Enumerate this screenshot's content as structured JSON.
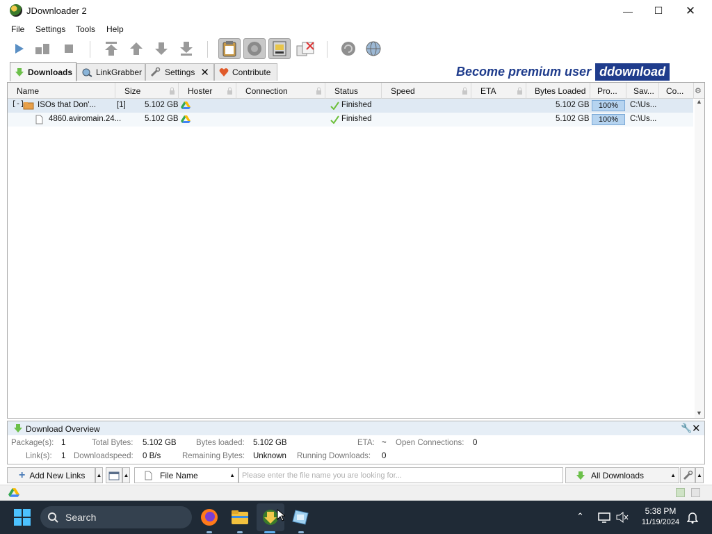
{
  "window": {
    "title": "JDownloader 2"
  },
  "menu": [
    "File",
    "Settings",
    "Tools",
    "Help"
  ],
  "tabs": [
    {
      "label": "Downloads"
    },
    {
      "label": "LinkGrabber"
    },
    {
      "label": "Settings"
    },
    {
      "label": "Contribute"
    }
  ],
  "premium": {
    "text": "Become premium user",
    "brand": "ddownload"
  },
  "columns": [
    "Name",
    "Size",
    "Hoster",
    "Connection",
    "Status",
    "Speed",
    "ETA",
    "Bytes Loaded",
    "Pro...",
    "Sav...",
    "Co..."
  ],
  "rows": [
    {
      "expander": "[-]",
      "name": "ISOs that Don'...",
      "count": "[1]",
      "size": "5.102 GB",
      "status": "Finished",
      "bytes": "5.102 GB",
      "progress": "100%",
      "progress_value": 100,
      "save": "C:\\Us..."
    },
    {
      "name": "4860.aviromain.24...",
      "size": "5.102 GB",
      "status": "Finished",
      "bytes": "5.102 GB",
      "progress": "100%",
      "progress_value": 100,
      "save": "C:\\Us..."
    }
  ],
  "overview": {
    "title": "Download Overview",
    "packages_label": "Package(s):",
    "packages": "1",
    "total_bytes_label": "Total Bytes:",
    "total_bytes": "5.102 GB",
    "bytes_loaded_label": "Bytes loaded:",
    "bytes_loaded": "5.102 GB",
    "eta_label": "ETA:",
    "eta": "~",
    "open_conn_label": "Open Connections:",
    "open_conn": "0",
    "links_label": "Link(s):",
    "links": "1",
    "speed_label": "Downloadspeed:",
    "speed": "0 B/s",
    "remaining_label": "Remaining Bytes:",
    "remaining": "Unknown",
    "running_label": "Running Downloads:",
    "running": "0"
  },
  "bottom": {
    "add_links": "Add New Links",
    "filter_mode": "File Name",
    "search_placeholder": "Please enter the file name you are looking for...",
    "view_select": "All Downloads"
  },
  "taskbar": {
    "search": "Search",
    "time": "5:38 PM",
    "date": "11/19/2024"
  },
  "colors": {
    "accent": "#1f3c8c",
    "progress": "#b6d4f0",
    "package_row": "#dfe9f3",
    "taskbar": "#1f2a36"
  }
}
